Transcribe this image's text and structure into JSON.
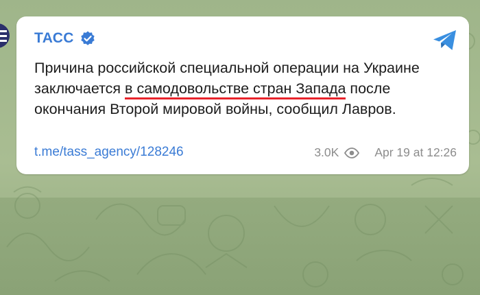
{
  "message": {
    "channel_name": "ТАСС",
    "text_before": "Причина российской специальной операции на Украине заключается ",
    "text_highlight": "в самодовольстве стран Запада",
    "text_after": " после окончания Второй мировой войны, сообщил Лавров.",
    "link": "t.me/tass_agency/128246",
    "views": "3.0K",
    "timestamp": "Apr 19 at 12:26"
  },
  "icons": {
    "verified": "verified-badge-icon",
    "share": "telegram-share-icon",
    "views": "eye-icon"
  },
  "colors": {
    "accent": "#3a7bd5",
    "highlight_underline": "#e8232b",
    "background": "#a9bd92"
  }
}
